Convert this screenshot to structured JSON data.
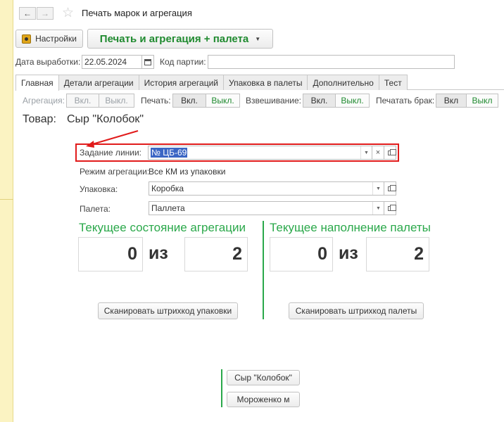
{
  "window": {
    "title": "Печать марок и агрегация"
  },
  "toolbar": {
    "settings_label": "Настройки",
    "print_agg_label": "Печать и агрегация + палета"
  },
  "header_fields": {
    "prod_date_label": "Дата выработки:",
    "prod_date_value": "22.05.2024",
    "batch_label": "Код партии:",
    "batch_value": ""
  },
  "tabs": [
    {
      "label": "Главная",
      "active": true
    },
    {
      "label": "Детали агрегации"
    },
    {
      "label": "История агрегаций"
    },
    {
      "label": "Упаковка в палеты"
    },
    {
      "label": "Дополнительно"
    },
    {
      "label": "Тест"
    }
  ],
  "toggles": {
    "aggregation": {
      "label": "Агрегация:",
      "on": "Вкл.",
      "off": "Выкл."
    },
    "print": {
      "label": "Печать:",
      "on": "Вкл.",
      "off": "Выкл."
    },
    "weighing": {
      "label": "Взвешивание:",
      "on": "Вкл.",
      "off": "Выкл."
    },
    "print_defect": {
      "label": "Печатать брак:",
      "on": "Вкл",
      "off": "Выкл"
    }
  },
  "product": {
    "label": "Товар:",
    "value": "Сыр \"Колобок\""
  },
  "form": {
    "line_task_label": "Задание линии:",
    "line_task_value": "№ ЦБ-69",
    "agg_mode_label": "Режим агрегации:",
    "agg_mode_value": "Все КМ из упаковки",
    "package_label": "Упаковка:",
    "package_value": "Коробка",
    "pallet_label": "Палета:",
    "pallet_value": "Паллета"
  },
  "agg_state": {
    "title": "Текущее состояние агрегации",
    "current": "0",
    "of": "из",
    "total": "2",
    "scan_label": "Сканировать штрихкод упаковки"
  },
  "pallet_fill": {
    "title": "Текущее наполнение палеты",
    "current": "0",
    "of": "из",
    "total": "2",
    "scan_label": "Сканировать штрихкод палеты"
  },
  "product_buttons": [
    "Сыр \"Колобок\"",
    "Мороженко м"
  ],
  "colors": {
    "accent_green": "#2aa84a",
    "highlight_red": "#e11b1b",
    "left_panel": "#fbf3c2"
  }
}
